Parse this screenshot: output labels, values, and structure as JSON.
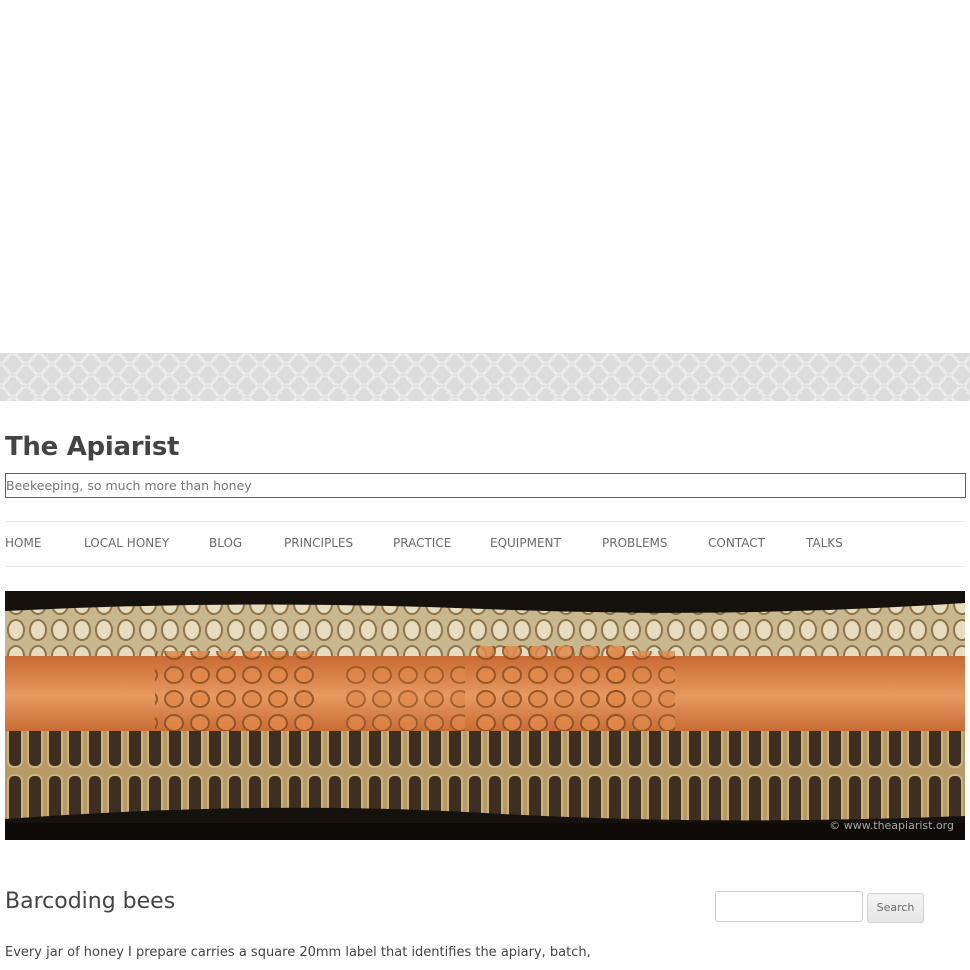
{
  "site": {
    "title": "The Apiarist",
    "tagline": "Beekeeping, so much more than honey"
  },
  "nav": {
    "items": [
      {
        "label": "HOME"
      },
      {
        "label": "LOCAL HONEY"
      },
      {
        "label": "BLOG"
      },
      {
        "label": "PRINCIPLES"
      },
      {
        "label": "PRACTICE"
      },
      {
        "label": "EQUIPMENT"
      },
      {
        "label": "PROBLEMS"
      },
      {
        "label": "CONTACT"
      },
      {
        "label": "TALKS"
      }
    ]
  },
  "header_image": {
    "alt_subject": "honeycomb-cross-section",
    "copyright": "© www.theapiarist.org"
  },
  "post": {
    "title": "Barcoding bees",
    "excerpt": "Every jar of honey I prepare carries a square 20mm label that identifies the apiary, batch,"
  },
  "search": {
    "placeholder": "",
    "button_label": "Search"
  },
  "colors": {
    "text": "#444444",
    "nav_text": "#6a6a6a",
    "tagline_border": "#b23a3a",
    "hex_band": "#dcdcdc"
  }
}
